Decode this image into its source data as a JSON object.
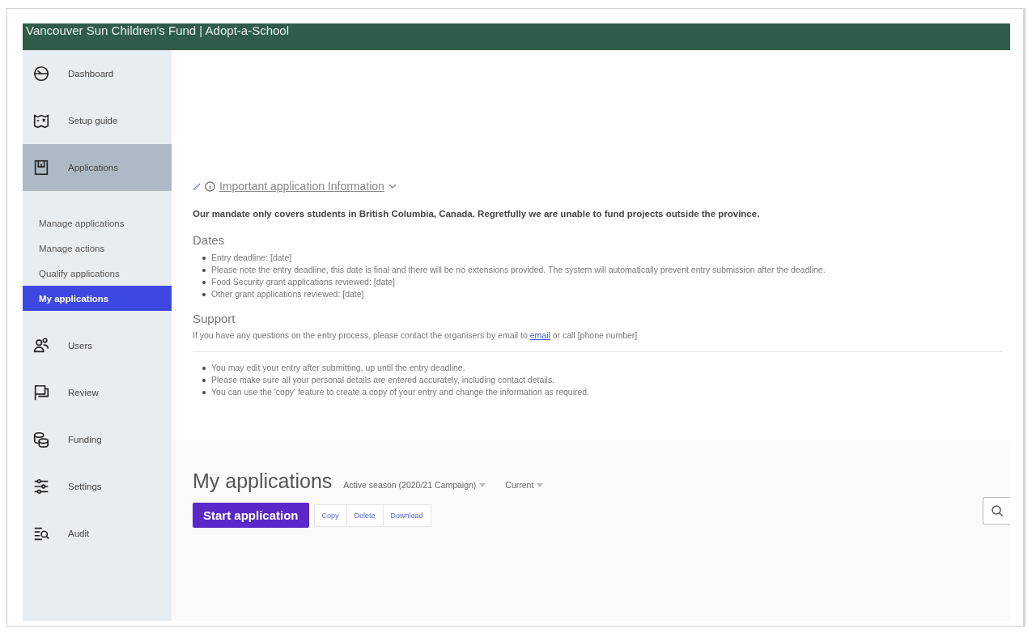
{
  "header": {
    "title": "Vancouver Sun Children's Fund | Adopt-a-School"
  },
  "sidebar": {
    "items": [
      {
        "label": "Dashboard",
        "selected": false
      },
      {
        "label": "Setup guide",
        "selected": false
      },
      {
        "label": "Applications",
        "selected": true,
        "expanded": true,
        "children": [
          {
            "label": "Manage applications",
            "selected": false
          },
          {
            "label": "Manage actions",
            "selected": false
          },
          {
            "label": "Qualify applications",
            "selected": false
          },
          {
            "label": "My applications",
            "selected": true
          }
        ]
      },
      {
        "label": "Users",
        "selected": false
      },
      {
        "label": "Review",
        "selected": false
      },
      {
        "label": "Funding",
        "selected": false
      },
      {
        "label": "Settings",
        "selected": false
      },
      {
        "label": "Audit",
        "selected": false
      }
    ]
  },
  "info": {
    "title": "Important application Information",
    "expanded": true,
    "notice": "Our mandate only covers students in British Columbia, Canada. Regretfully we are unable to fund projects outside the province.",
    "sections": [
      {
        "heading": "Dates",
        "bullets": [
          "Entry deadline: [date]",
          "Please note the entry deadline, this date is final and there will be no extensions provided. The system will automatically prevent entry submission after the deadline.",
          "Food Security grant applications reviewed: [date]",
          "Other grant applications reviewed: [date]"
        ]
      }
    ],
    "support": {
      "heading": "Support",
      "text_before": "If you have any questions on the entry process, please contact the organisers by email to",
      "link": "email",
      "text_after": "or call [phone number]"
    },
    "tips": [
      "You may edit your entry after submitting, up until the entry deadline.",
      "Please make sure all your personal details are entered accurately, including contact details.",
      "You can use the 'copy' feature to create a copy of your entry and change the information as required."
    ]
  },
  "applications": {
    "title": "My applications",
    "filters": [
      "Active season (2020/21 Campaign)",
      "Current"
    ],
    "primary_button": "Start application",
    "actions": [
      "Copy",
      "Delete",
      "Download"
    ]
  }
}
